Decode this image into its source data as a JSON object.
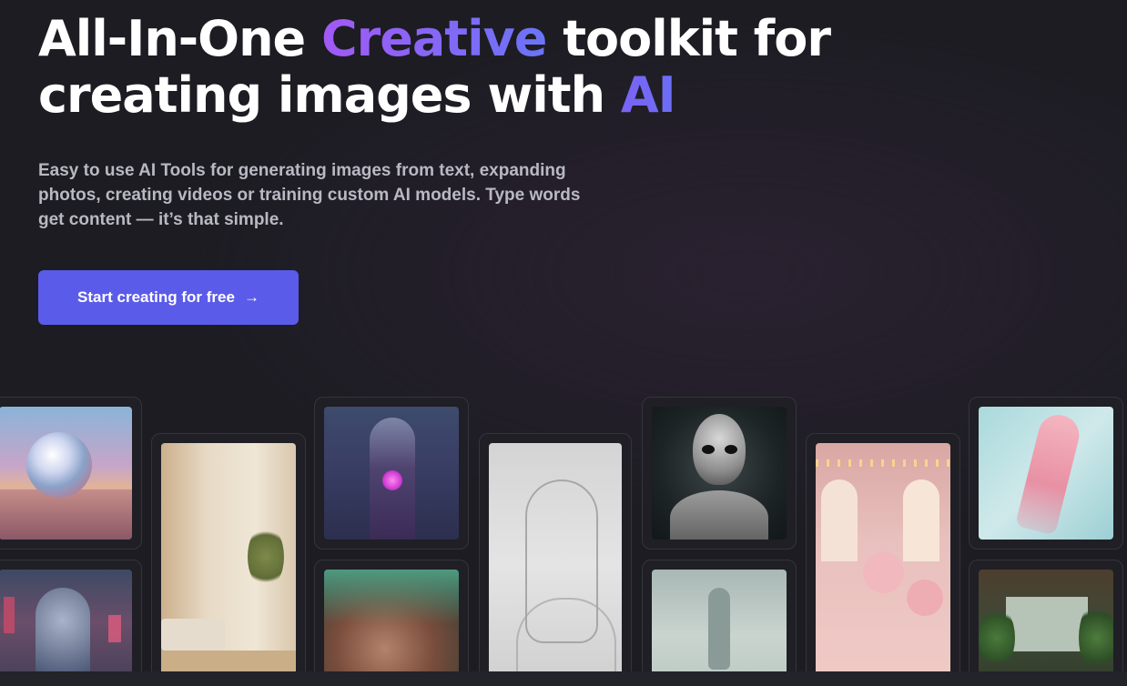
{
  "hero": {
    "headline_line1_pre": "All-In-One ",
    "headline_accent1": "Creative",
    "headline_line1_post": " toolkit for",
    "headline_line2_pre": "creating images with ",
    "headline_accent2": "AI",
    "subtitle": "Easy to use AI Tools for generating images from text, expanding photos, creating videos or training custom AI models. Type words get content — it’s that simple.",
    "cta_label": "Start creating for free",
    "cta_arrow": "→"
  },
  "colors": {
    "background": "#1c1c22",
    "cta_background": "#5b5bea",
    "accent_gradient_start": "#a259f5",
    "accent_gradient_end": "#6a74f7",
    "subtitle_text": "#b9b9c3"
  },
  "gallery": {
    "images": [
      {
        "name": "crystal-sphere-landscape"
      },
      {
        "name": "neon-cyborg-woman"
      },
      {
        "name": "minimal-bedroom"
      },
      {
        "name": "robot-glowing-heart"
      },
      {
        "name": "face-glitter-paint"
      },
      {
        "name": "wire-sculpture-head"
      },
      {
        "name": "alien-bust"
      },
      {
        "name": "misty-figure"
      },
      {
        "name": "pink-teddy-room"
      },
      {
        "name": "xray-runner"
      },
      {
        "name": "greenhouse-interior"
      }
    ]
  }
}
